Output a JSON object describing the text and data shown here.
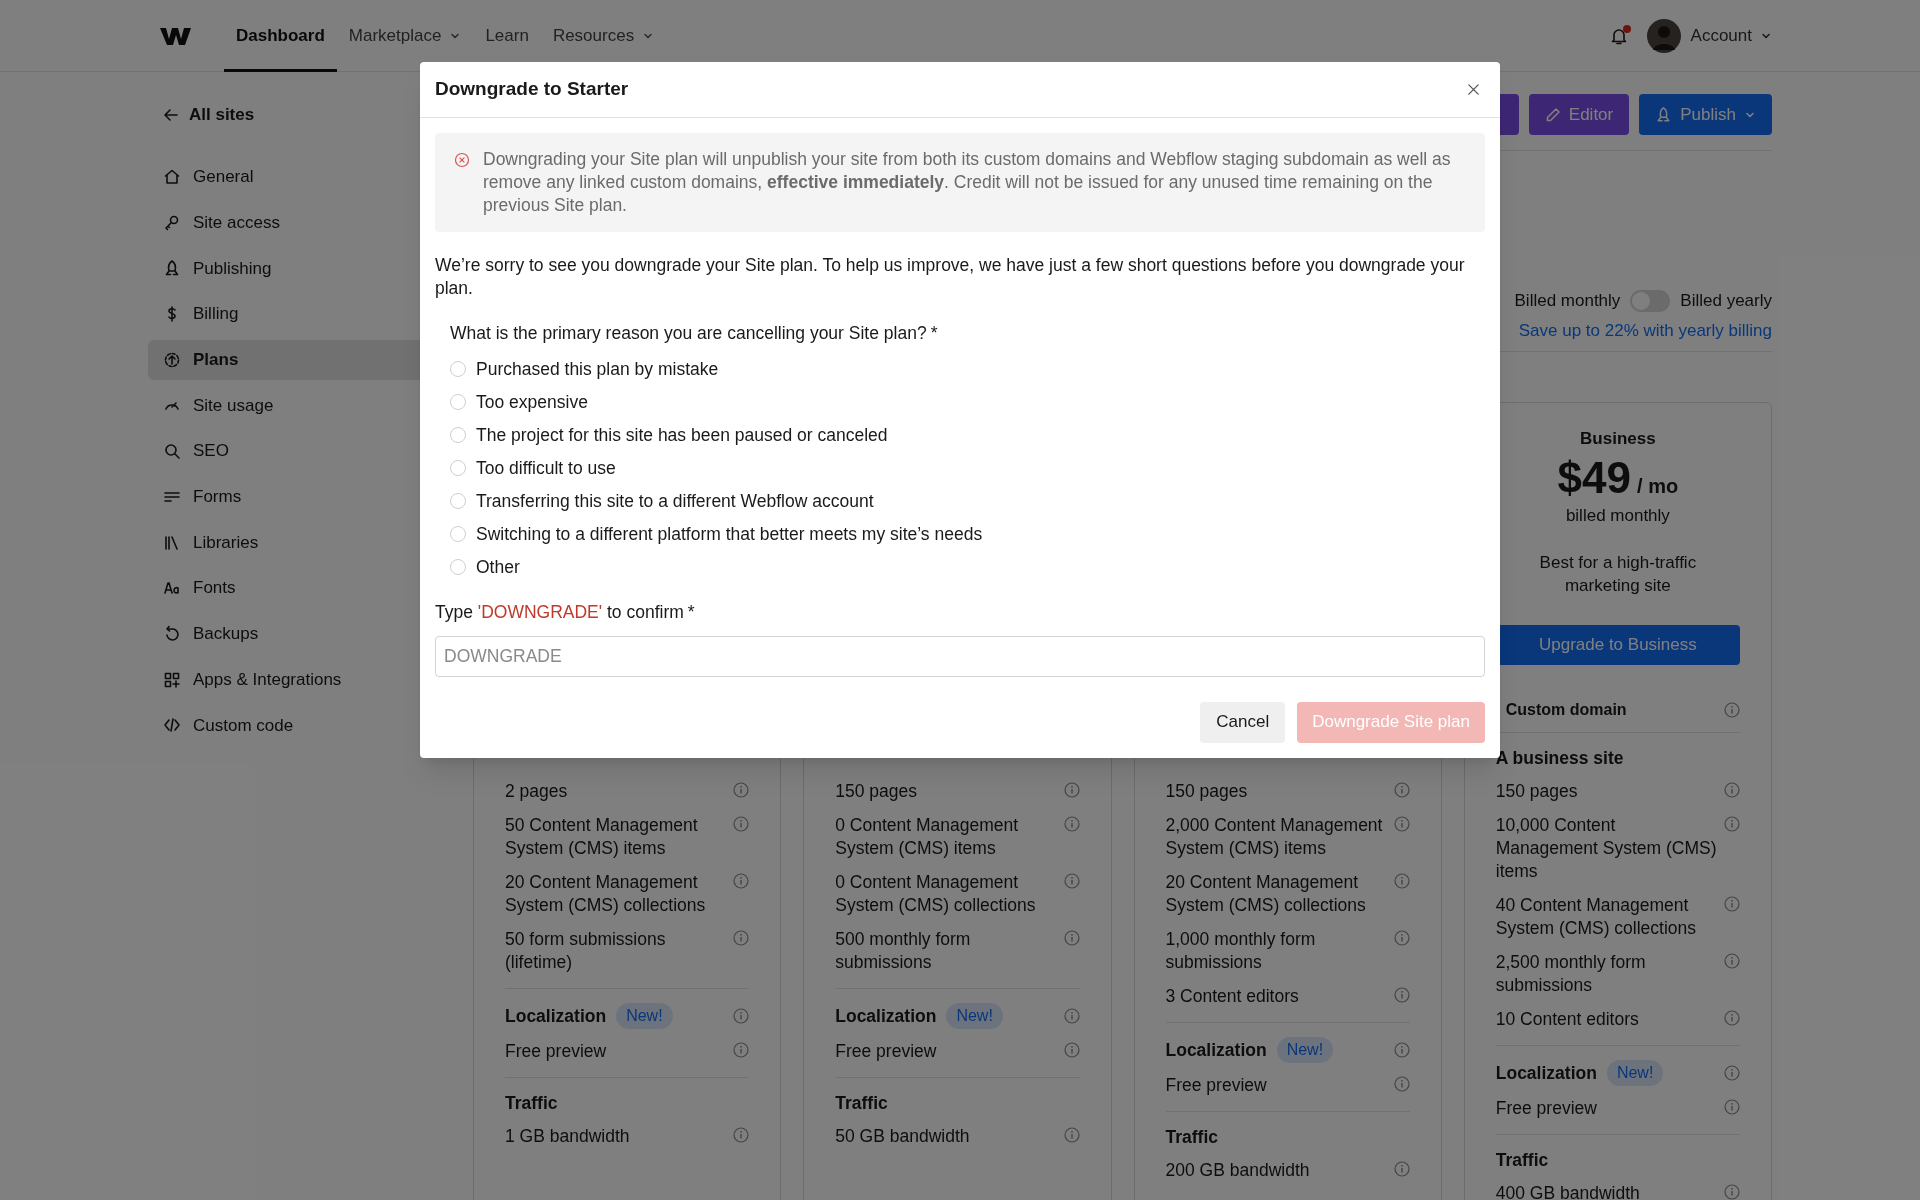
{
  "nav": {
    "items": [
      {
        "label": "Dashboard",
        "selected": true,
        "dropdown": false
      },
      {
        "label": "Marketplace",
        "selected": false,
        "dropdown": true
      },
      {
        "label": "Learn",
        "selected": false,
        "dropdown": false
      },
      {
        "label": "Resources",
        "selected": false,
        "dropdown": true
      }
    ],
    "notifications": {
      "unread": true
    },
    "account": "Account"
  },
  "sidebar": {
    "back": "All sites",
    "items": [
      {
        "label": "General",
        "selected": false
      },
      {
        "label": "Site access",
        "selected": false
      },
      {
        "label": "Publishing",
        "selected": false
      },
      {
        "label": "Billing",
        "selected": false
      },
      {
        "label": "Plans",
        "selected": true
      },
      {
        "label": "Site usage",
        "selected": false
      },
      {
        "label": "SEO",
        "selected": false
      },
      {
        "label": "Forms",
        "selected": false
      },
      {
        "label": "Libraries",
        "selected": false
      },
      {
        "label": "Fonts",
        "selected": false
      },
      {
        "label": "Backups",
        "selected": false
      },
      {
        "label": "Apps & Integrations",
        "selected": false
      },
      {
        "label": "Custom code",
        "selected": false
      }
    ]
  },
  "toolbar": {
    "buttons": [
      {
        "kind": "hidden"
      },
      {
        "kind": "editor",
        "label": "Editor"
      },
      {
        "kind": "publish",
        "label": "Publish"
      }
    ]
  },
  "billing": {
    "monthly_label": "Billed monthly",
    "yearly": false,
    "yearly_label": "Billed yearly",
    "link": "Save up to 22% with yearly billing"
  },
  "plans": [
    {
      "sections": [
        {
          "rows": [
            "2 pages",
            "50 Content Management System (CMS) items",
            "20 Content Management System (CMS) collections",
            "50 form submissions (lifetime)"
          ]
        },
        {
          "title": "Localization",
          "badge": "New!",
          "rows": [
            "Free preview"
          ]
        },
        {
          "title": "Traffic",
          "rows": [
            "1 GB bandwidth"
          ]
        }
      ]
    },
    {
      "sections": [
        {
          "rows": [
            "150 pages",
            "0 Content Management System (CMS) items",
            "0 Content Management System (CMS) collections",
            "500 monthly form submissions"
          ]
        },
        {
          "title": "Localization",
          "badge": "New!",
          "rows": [
            "Free preview"
          ]
        },
        {
          "title": "Traffic",
          "rows": [
            "50 GB bandwidth"
          ]
        }
      ]
    },
    {
      "sections": [
        {
          "rows": [
            "150 pages",
            "2,000 Content Management System (CMS) items",
            "20 Content Management System (CMS) collections",
            "1,000 monthly form submissions",
            "3 Content editors"
          ]
        },
        {
          "title": "Localization",
          "badge": "New!",
          "rows": [
            "Free preview"
          ]
        },
        {
          "title": "Traffic",
          "rows": [
            "200 GB bandwidth"
          ]
        }
      ]
    },
    {
      "header": {
        "name": "Business",
        "price": "$49",
        "period": "/ mo",
        "billing": "billed monthly",
        "description": "Best for a high-traffic marketing site",
        "button": "Upgrade to Business",
        "top_feature": "Custom domain"
      },
      "sections": [
        {
          "title": "A business site",
          "rows": [
            "150 pages",
            "10,000 Content Management System (CMS) items",
            "40 Content Management System (CMS) collections",
            "2,500 monthly form submissions",
            "10 Content editors"
          ]
        },
        {
          "title": "Localization",
          "badge": "New!",
          "rows": [
            "Free preview"
          ]
        },
        {
          "title": "Traffic",
          "rows": [
            "400 GB bandwidth"
          ]
        }
      ]
    }
  ],
  "modal": {
    "title": "Downgrade to Starter",
    "alert": "Downgrading your Site plan will unpublish your site from both its custom domains and Webflow staging subdomain as well as remove any linked custom domains, **effective immediately**. Credit will not be issued for any unused time remaining on the previous Site plan.",
    "intro": "We’re sorry to see you downgrade your Site plan. To help us improve, we have just a few short questions before you downgrade your plan.",
    "question": "What is the primary reason you are cancelling your Site plan?",
    "question_required": "*",
    "reasons": [
      {
        "label": "Purchased this plan by mistake",
        "selected": false
      },
      {
        "label": "Too expensive",
        "selected": false
      },
      {
        "label": "The project for this site has been paused or canceled",
        "selected": false
      },
      {
        "label": "Too difficult to use",
        "selected": false
      },
      {
        "label": "Transferring this site to a different Webflow account",
        "selected": false
      },
      {
        "label": "Switching to a different platform that better meets my site’s needs",
        "selected": false
      },
      {
        "label": "Other",
        "selected": false
      }
    ],
    "confirm": {
      "before": "Type ",
      "keyword": "'DOWNGRADE'",
      "after": " to confirm",
      "required": "*",
      "placeholder": "DOWNGRADE"
    },
    "cancel": "Cancel",
    "submit": {
      "label": "Downgrade Site plan",
      "disabled": true
    }
  }
}
